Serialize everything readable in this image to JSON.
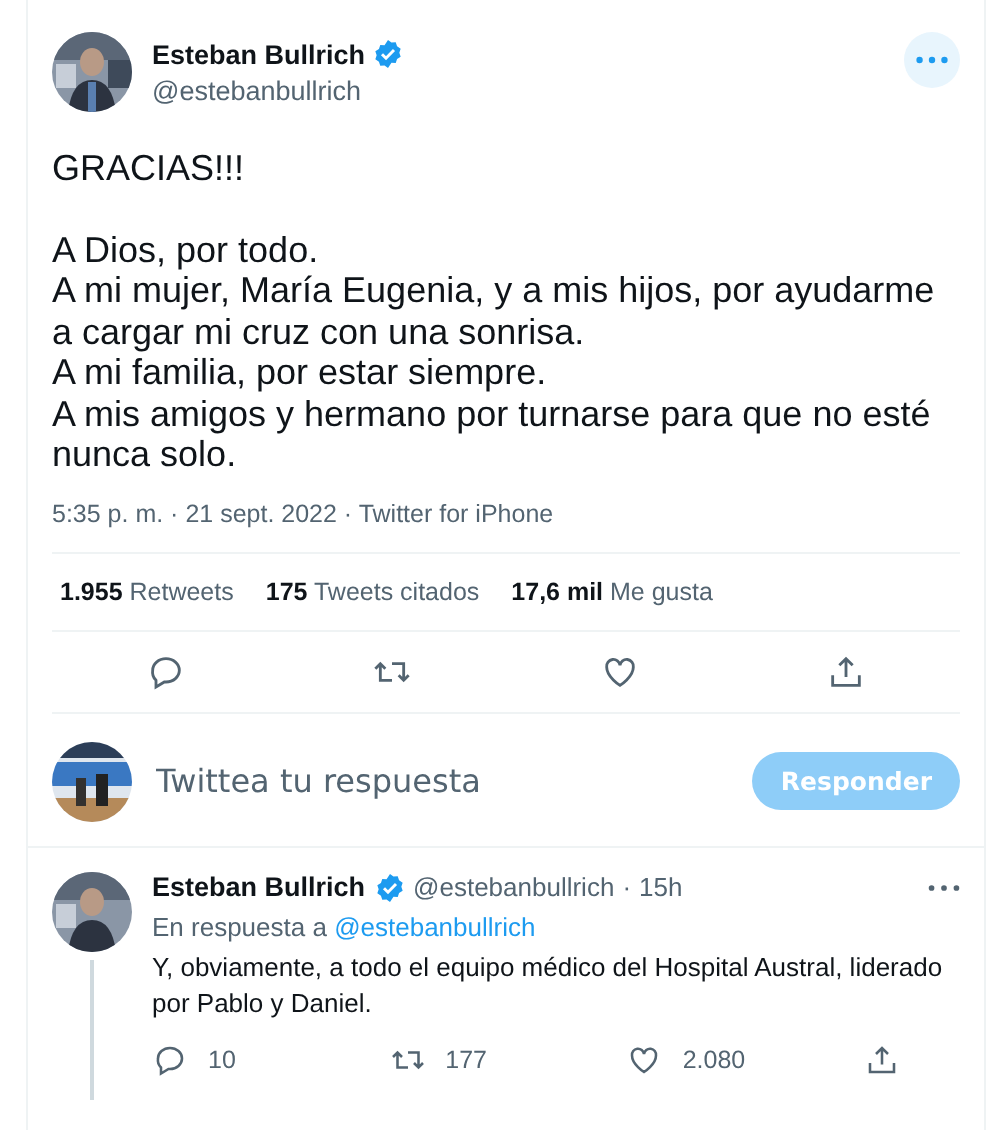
{
  "tweet": {
    "author": {
      "name": "Esteban Bullrich",
      "handle": "@estebanbullrich",
      "verified": true
    },
    "paragraphs": [
      "GRACIAS!!!",
      "A Dios, por todo.\nA mi mujer, María Eugenia, y a mis hijos, por ayudarme a cargar mi cruz con una sonrisa.\nA mi familia, por estar siempre.\nA mis amigos y hermano por turnarse para que no esté nunca solo."
    ],
    "meta": "5:35 p. m. · 21 sept. 2022 · Twitter for iPhone",
    "stats": [
      {
        "count": "1.955",
        "label": "Retweets"
      },
      {
        "count": "175",
        "label": "Tweets citados"
      },
      {
        "count": "17,6 mil",
        "label": "Me gusta"
      }
    ],
    "actions": [
      {
        "kind": "reply"
      },
      {
        "kind": "retweet"
      },
      {
        "kind": "like"
      },
      {
        "kind": "share"
      }
    ]
  },
  "composer": {
    "placeholder": "Twittea tu respuesta",
    "button": "Responder",
    "disabled": true
  },
  "replies": [
    {
      "author": {
        "name": "Esteban Bullrich",
        "handle": "@estebanbullrich",
        "verified": true
      },
      "separator": "·",
      "time": "15h",
      "in_reply_prefix": "En respuesta a",
      "in_reply_to": "@estebanbullrich",
      "text": "Y, obviamente, a todo el equipo médico del Hospital Austral, liderado por Pablo y Daniel.",
      "actions": [
        {
          "kind": "reply",
          "count": "10"
        },
        {
          "kind": "retweet",
          "count": "177"
        },
        {
          "kind": "like",
          "count": "2.080"
        },
        {
          "kind": "share"
        }
      ]
    }
  ]
}
